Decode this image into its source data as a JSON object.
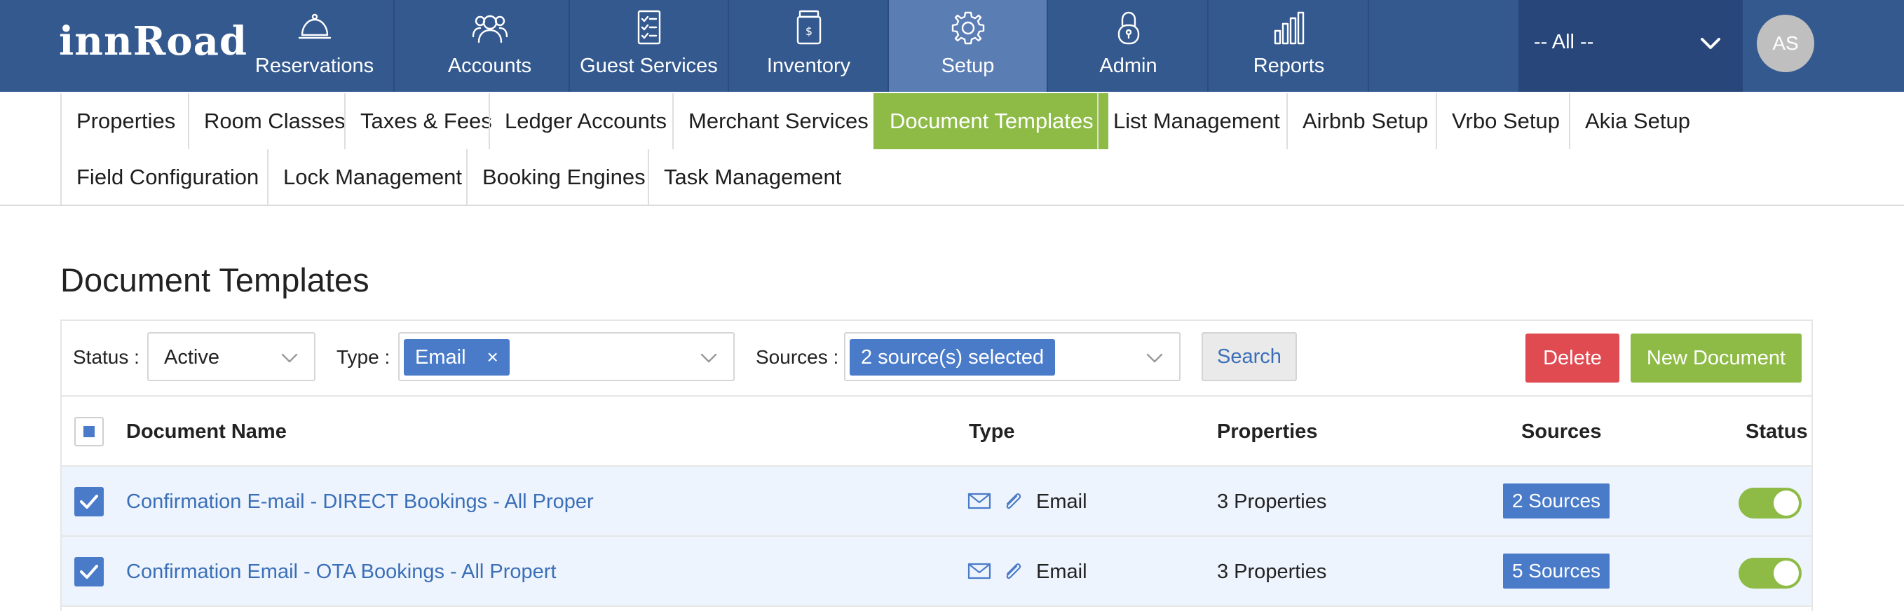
{
  "brand": {
    "logo_text": "innRoad"
  },
  "topnav": {
    "items": [
      {
        "label": "Reservations",
        "icon": "bell-icon"
      },
      {
        "label": "Accounts",
        "icon": "users-icon"
      },
      {
        "label": "Guest Services",
        "icon": "checklist-icon"
      },
      {
        "label": "Inventory",
        "icon": "jar-icon"
      },
      {
        "label": "Setup",
        "icon": "gear-icon",
        "active": true
      },
      {
        "label": "Admin",
        "icon": "lock-icon"
      },
      {
        "label": "Reports",
        "icon": "bar-chart-icon"
      }
    ],
    "property_select": {
      "value": "-- All --"
    },
    "avatar": {
      "initials": "AS"
    }
  },
  "subnav": {
    "items": [
      {
        "label": "Properties"
      },
      {
        "label": "Room Classes"
      },
      {
        "label": "Taxes & Fees"
      },
      {
        "label": "Ledger Accounts"
      },
      {
        "label": "Merchant Services"
      },
      {
        "label": "Document Templates",
        "active": true
      },
      {
        "label": "List Management"
      },
      {
        "label": "Airbnb Setup"
      },
      {
        "label": "Vrbo Setup"
      },
      {
        "label": "Akia Setup"
      },
      {
        "label": "Field Configuration"
      },
      {
        "label": "Lock Management"
      },
      {
        "label": "Booking Engines"
      },
      {
        "label": "Task Management"
      }
    ]
  },
  "page": {
    "title": "Document Templates"
  },
  "filters": {
    "status_label": "Status :",
    "status_value": "Active",
    "type_label": "Type :",
    "type_chip": "Email",
    "type_chip_remove": "×",
    "sources_label": "Sources :",
    "sources_chip": "2 source(s) selected",
    "search_label": "Search",
    "delete_label": "Delete",
    "new_label": "New Document"
  },
  "table": {
    "headers": {
      "name": "Document Name",
      "type": "Type",
      "properties": "Properties",
      "sources": "Sources",
      "status": "Status"
    },
    "rows": [
      {
        "name": "Confirmation E-mail - DIRECT Bookings - All Proper",
        "type": "Email",
        "properties": "3 Properties",
        "sources": "2 Sources",
        "checked": true,
        "status_on": true
      },
      {
        "name": "Confirmation Email - OTA Bookings - All Propert",
        "type": "Email",
        "properties": "3 Properties",
        "sources": "5 Sources",
        "checked": true,
        "status_on": true
      }
    ]
  },
  "colors": {
    "nav_bg": "#34598f",
    "nav_active": "#5a7db3",
    "accent_green": "#8dbb46",
    "accent_blue": "#4a7bc9",
    "danger_red": "#e04a51",
    "row_highlight": "#eef4fd"
  }
}
